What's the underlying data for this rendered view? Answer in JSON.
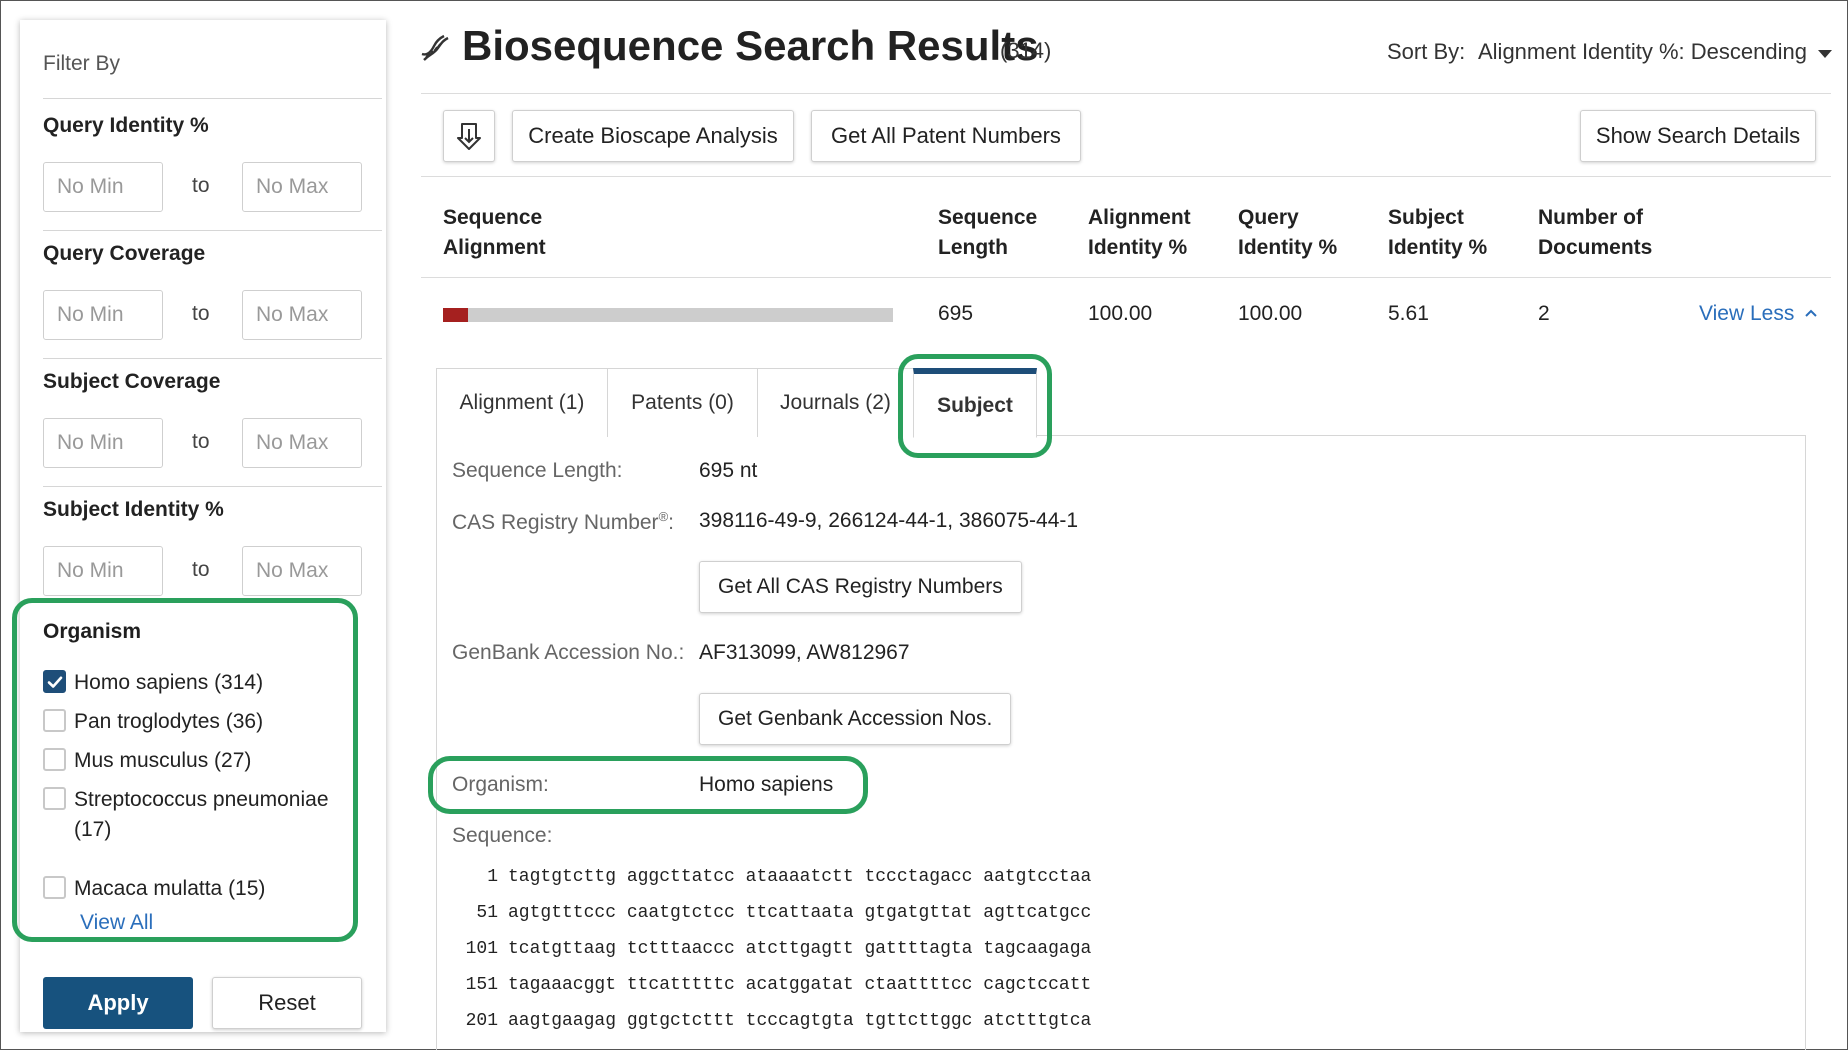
{
  "sidebar": {
    "filter_title": "Filter By",
    "to_label": "to",
    "groups": [
      {
        "label": "Query Identity %",
        "min_placeholder": "No Min",
        "max_placeholder": "No Max"
      },
      {
        "label": "Query Coverage",
        "min_placeholder": "No Min",
        "max_placeholder": "No Max"
      },
      {
        "label": "Subject Coverage",
        "min_placeholder": "No Min",
        "max_placeholder": "No Max"
      },
      {
        "label": "Subject Identity %",
        "min_placeholder": "No Min",
        "max_placeholder": "No Max"
      }
    ],
    "organism": {
      "title": "Organism",
      "items": [
        {
          "label": "Homo sapiens (314)",
          "checked": true
        },
        {
          "label": "Pan troglodytes (36)",
          "checked": false
        },
        {
          "label": "Mus musculus (27)",
          "checked": false
        },
        {
          "label": "Streptococcus pneumoniae (17)",
          "checked": false
        },
        {
          "label": "Macaca mulatta (15)",
          "checked": false
        }
      ],
      "view_all": "View All"
    },
    "apply_label": "Apply",
    "reset_label": "Reset"
  },
  "header": {
    "icon": "dna-icon",
    "title": "Biosequence Search Results",
    "count": "(314)",
    "sort_label": "Sort By:",
    "sort_value": "Alignment Identity %: Descending"
  },
  "toolbar": {
    "download_icon": "download-icon",
    "create_analysis": "Create Bioscape Analysis",
    "get_patents": "Get All Patent Numbers",
    "show_details": "Show Search Details"
  },
  "table": {
    "headers": [
      "Sequence Alignment",
      "Sequence Length",
      "Alignment Identity %",
      "Query Identity %",
      "Subject Identity %",
      "Number of Documents"
    ],
    "row": {
      "alignment_fraction": 0.055,
      "sequence_length": "695",
      "alignment_identity": "100.00",
      "query_identity": "100.00",
      "subject_identity": "5.61",
      "documents": "2",
      "view_less": "View Less"
    }
  },
  "tabs": [
    {
      "label": "Alignment (1)",
      "active": false
    },
    {
      "label": "Patents (0)",
      "active": false
    },
    {
      "label": "Journals (2)",
      "active": false
    },
    {
      "label": "Subject",
      "active": true
    }
  ],
  "subject": {
    "seq_length_label": "Sequence Length:",
    "seq_length_value": "695 nt",
    "cas_label": "CAS Registry Number",
    "cas_sup": "®",
    "cas_colon": ":",
    "cas_value": "398116-49-9, 266124-44-1, 386075-44-1",
    "cas_button": "Get All CAS Registry Numbers",
    "genbank_label": "GenBank Accession No.:",
    "genbank_value": "AF313099, AW812967",
    "genbank_button": "Get Genbank Accession Nos.",
    "organism_label": "Organism:",
    "organism_value": "Homo sapiens",
    "sequence_label": "Sequence:",
    "sequence_lines": [
      {
        "num": "1",
        "seq": "tagtgtcttg aggcttatcc ataaaatctt tccctagacc aatgtcctaa"
      },
      {
        "num": "51",
        "seq": "agtgtttccc caatgtctcc ttcattaata gtgatgttat agttcatgcc"
      },
      {
        "num": "101",
        "seq": "tcatgttaag tctttaaccc atcttgagtt gattttagta tagcaagaga"
      },
      {
        "num": "151",
        "seq": "tagaaacggt ttcatttttc acatggatat ctaattttcc cagctccatt"
      },
      {
        "num": "201",
        "seq": "aagtgaagag ggtgctcttt tcccagtgta tgttcttggc atctttgtca"
      }
    ]
  },
  "colors": {
    "brand_dark": "#1e4e79",
    "highlight_green": "#2aa05c",
    "link_blue": "#2a6ebb",
    "alignment_bar": "#a5201f"
  }
}
